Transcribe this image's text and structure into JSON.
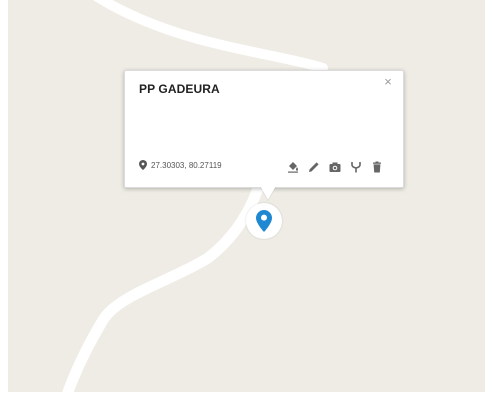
{
  "popup": {
    "title": "PP GADEURA",
    "close_symbol": "×",
    "coordinates": "27.30303, 80.27119",
    "actions": [
      {
        "name": "paint-bucket-icon"
      },
      {
        "name": "pencil-icon"
      },
      {
        "name": "camera-icon"
      },
      {
        "name": "fork-icon"
      },
      {
        "name": "trash-icon"
      }
    ]
  },
  "marker": {
    "icon": "map-pin-icon",
    "color": "#1e88d2"
  },
  "colors": {
    "map_background": "#eeece4",
    "road": "#ffffff"
  }
}
